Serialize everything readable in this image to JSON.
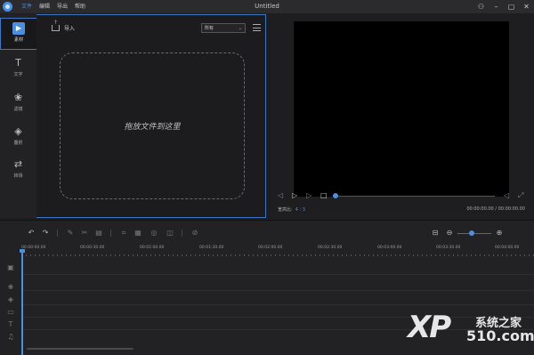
{
  "window": {
    "title": "Untitled",
    "menus": [
      "文件",
      "编辑",
      "导出",
      "帮助"
    ],
    "controls": [
      "user-icon",
      "minimize-icon",
      "maximize-icon",
      "close-icon"
    ]
  },
  "sidebar": {
    "items": [
      {
        "label": "素材",
        "icon": "media-icon",
        "active": true
      },
      {
        "label": "文字",
        "icon": "text-icon",
        "active": false
      },
      {
        "label": "滤镜",
        "icon": "filter-icon",
        "active": false
      },
      {
        "label": "叠附",
        "icon": "overlay-icon",
        "active": false
      },
      {
        "label": "转场",
        "icon": "transition-icon",
        "active": false
      }
    ]
  },
  "media": {
    "import_label": "导入",
    "filter_value": "所有",
    "drop_text": "拖放文件到这里"
  },
  "preview": {
    "aspect_label": "宽高比:",
    "aspect_value": "4 : 3",
    "time": "00:00:00.00 / 00:00:00.00"
  },
  "timeline": {
    "ticks": [
      "00:00:00.00",
      "00:00:30.00",
      "00:01:00.00",
      "00:01:30.00",
      "00:02:00.00",
      "00:02:30.00",
      "00:03:00.00",
      "00:03:30.00",
      "00:04:00.00"
    ]
  },
  "watermark": {
    "logo": "XP",
    "line1": "系统之家",
    "line2": "510.com"
  },
  "colors": {
    "accent": "#4a90e2",
    "background": "#1e1e20"
  }
}
